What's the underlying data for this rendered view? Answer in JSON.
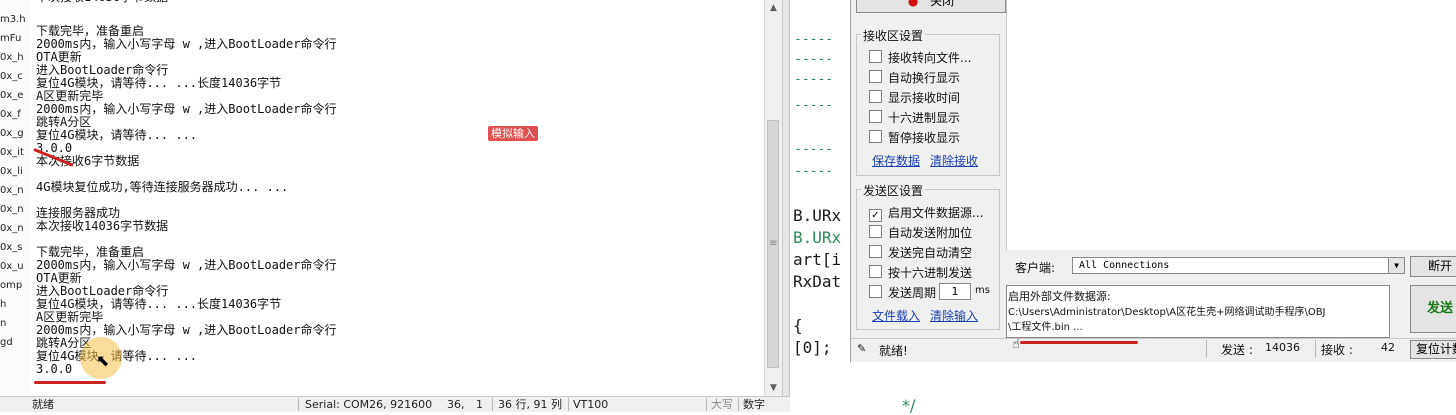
{
  "file_tree": [
    "m3.h",
    "mFu",
    "0x_h",
    "0x_c",
    "0x_e",
    "0x_f",
    "0x_g",
    "0x_it",
    "0x_li",
    "0x_n",
    "0x_n",
    "0x_n",
    "0x_s",
    "0x_u",
    "omp",
    "h",
    "n",
    "gd"
  ],
  "terminal": {
    "lines": [
      "本次接收14036字节数据",
      "",
      "下载完毕，准备重启",
      "2000ms内，输入小写字母 w ,进入BootLoader命令行",
      "OTA更新",
      "进入BootLoader命令行",
      "复位4G模块，请等待... ...长度14036字节",
      "A区更新完毕",
      "2000ms内，输入小写字母 w ,进入BootLoader命令行",
      "跳转A分区",
      "复位4G模块，请等待... ...",
      "3.0.0",
      "本次接收6字节数据",
      "",
      "4G模块复位成功,等待连接服务器成功... ...",
      "",
      "连接服务器成功",
      "本次接收14036字节数据",
      "",
      "下载完毕，准备重启",
      "2000ms内，输入小写字母 w ,进入BootLoader命令行",
      "OTA更新",
      "进入BootLoader命令行",
      "复位4G模块，请等待... ...长度14036字节",
      "A区更新完毕",
      "2000ms内，输入小写字母 w ,进入BootLoader命令行",
      "跳转A分区",
      "复位4G模块，请等待... ...",
      "3.0.0"
    ],
    "annotation_label": "模拟输入"
  },
  "status_bar": {
    "ready": "就绪",
    "serial": "Serial: COM26, 921600",
    "pos_row": "36,",
    "pos_col": "1",
    "rows_cols": "36 行, 91 列",
    "emulation": "VT100",
    "caps": "大写",
    "num": "数字"
  },
  "code_editor": {
    "dashes": [
      "-----",
      "-----",
      "-----",
      "-----",
      "-----",
      "-----"
    ],
    "lines": [
      "B.URx",
      "B.URx",
      "art[i",
      "RxDat",
      "{",
      "[0];"
    ],
    "footer": "*/"
  },
  "tool_panel": {
    "top_button": "关闭",
    "receive_group": {
      "title": "接收区设置",
      "options": [
        {
          "label": "接收转向文件...",
          "checked": false
        },
        {
          "label": "自动换行显示",
          "checked": false
        },
        {
          "label": "显示接收时间",
          "checked": false
        },
        {
          "label": "十六进制显示",
          "checked": false
        },
        {
          "label": "暂停接收显示",
          "checked": false
        }
      ],
      "save_link": "保存数据",
      "clear_link": "清除接收"
    },
    "send_group": {
      "title": "发送区设置",
      "options": [
        {
          "label": "启用文件数据源...",
          "checked": true
        },
        {
          "label": "自动发送附加位",
          "checked": false
        },
        {
          "label": "发送完自动清空",
          "checked": false
        },
        {
          "label": "按十六进制发送",
          "checked": false
        }
      ],
      "period_label": "发送周期",
      "period_value": "1",
      "period_unit": "ms",
      "load_link": "文件载入",
      "clear_link": "清除输入"
    },
    "client_label": "客户端:",
    "client_select": "All Connections",
    "disconnect_button": "断开",
    "file_source_text": [
      "启用外部文件数据源:",
      "C:\\Users\\Administrator\\Desktop\\A区花生壳+网络调试助手程序\\OBJ",
      "\\工程文件.bin ..."
    ],
    "send_button": "发送",
    "status": {
      "ready": "就绪!",
      "send_label": "发送 :",
      "send_count": "14036",
      "recv_label": "接收 :",
      "recv_count": "42",
      "reset_button": "复位计数"
    }
  }
}
